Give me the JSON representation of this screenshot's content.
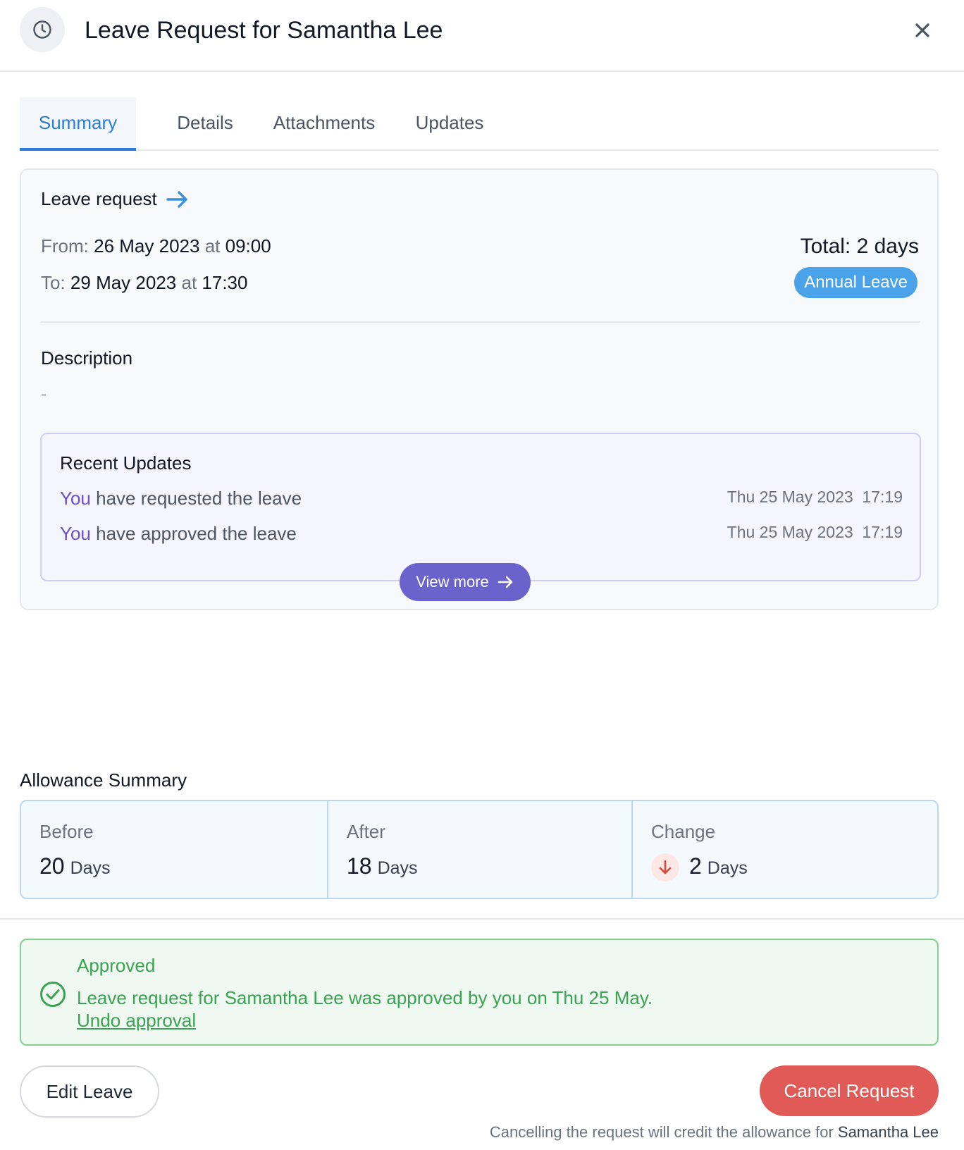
{
  "header": {
    "title": "Leave Request for Samantha Lee",
    "icon": "clock-icon",
    "close_icon": "close-icon"
  },
  "tabs": [
    {
      "label": "Summary",
      "active": true
    },
    {
      "label": "Details",
      "active": false
    },
    {
      "label": "Attachments",
      "active": false
    },
    {
      "label": "Updates",
      "active": false
    }
  ],
  "leave": {
    "title": "Leave request",
    "from_label": "From:",
    "from_date": "26 May 2023",
    "at_word": "at",
    "from_time": "09:00",
    "to_label": "To:",
    "to_date": "29 May 2023",
    "to_time": "17:30",
    "total": "Total: 2 days",
    "type_badge": "Annual Leave",
    "description_label": "Description",
    "description_value": "-"
  },
  "recent_updates": {
    "title": "Recent Updates",
    "items": [
      {
        "actor": "You",
        "text": "have requested the leave",
        "time": "Thu 25 May 2023  17:19"
      },
      {
        "actor": "You",
        "text": "have approved the leave",
        "time": "Thu 25 May 2023  17:19"
      }
    ],
    "view_more_label": "View more"
  },
  "allowance": {
    "title": "Allowance Summary",
    "before": {
      "label": "Before",
      "value": "20",
      "unit": "Days"
    },
    "after": {
      "label": "After",
      "value": "18",
      "unit": "Days"
    },
    "change": {
      "label": "Change",
      "value": "2",
      "unit": "Days",
      "direction": "down"
    }
  },
  "approval": {
    "title": "Approved",
    "text": "Leave request for Samantha Lee was approved by you on Thu 25 May.",
    "undo_label": "Undo approval"
  },
  "actions": {
    "edit_label": "Edit Leave",
    "cancel_label": "Cancel Request",
    "footnote_prefix": "Cancelling the request will credit the allowance for",
    "footnote_name": "Samantha Lee"
  },
  "colors": {
    "accent_blue": "#2f7bd6",
    "badge_blue": "#4aa3e8",
    "purple": "#6b63cc",
    "success_green": "#3aa352",
    "danger_red": "#e05b57"
  }
}
